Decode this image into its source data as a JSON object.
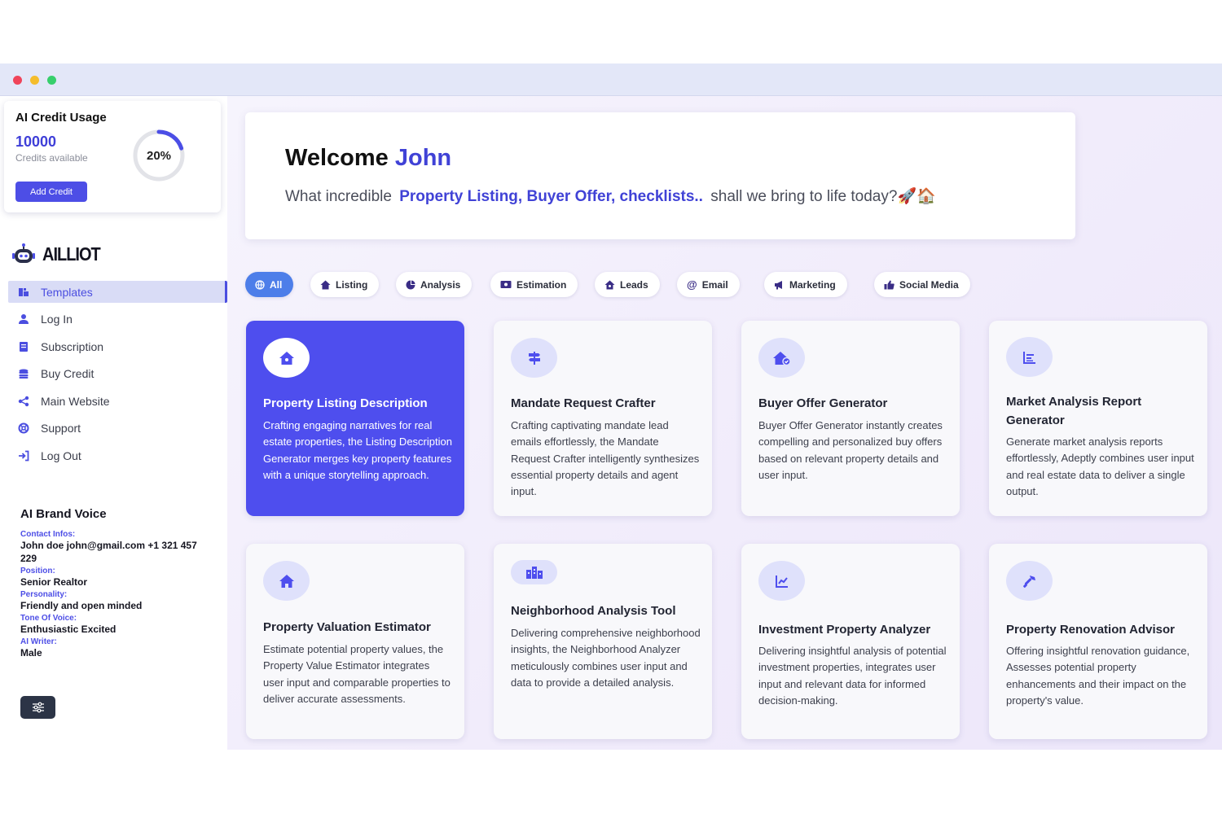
{
  "credit": {
    "title": "AI Credit Usage",
    "amount": "10000",
    "subtitle": "Credits available",
    "button": "Add Credit",
    "percent": "20%",
    "percent_value": 0.2
  },
  "logo": {
    "text": "AILLIOT"
  },
  "nav": {
    "items": [
      {
        "label": "Templates",
        "icon": "templates-icon"
      },
      {
        "label": "Log In",
        "icon": "user-icon"
      },
      {
        "label": "Subscription",
        "icon": "receipt-icon"
      },
      {
        "label": "Buy Credit",
        "icon": "coins-icon"
      },
      {
        "label": "Main Website",
        "icon": "share-icon"
      },
      {
        "label": "Support",
        "icon": "lifebuoy-icon"
      },
      {
        "label": "Log Out",
        "icon": "logout-icon"
      }
    ]
  },
  "brand": {
    "title": "AI Brand Voice",
    "contact_label": "Contact Infos:",
    "contact_value": "John doe john@gmail.com +1 321 457 229",
    "position_label": "Position:",
    "position_value": "Senior Realtor",
    "personality_label": "Personality:",
    "personality_value": "Friendly and open minded",
    "tone_label": "Tone Of Voice:",
    "tone_value": "Enthusiastic Excited",
    "writer_label": "AI Writer:",
    "writer_value": "Male"
  },
  "welcome": {
    "greeting": "Welcome",
    "name": "John",
    "prefix": "What incredible",
    "highlight": "Property Listing, Buyer Offer, checklists..",
    "suffix": "shall we bring to life today?🚀🏠"
  },
  "filters": [
    {
      "label": "All",
      "icon": "globe-icon"
    },
    {
      "label": "Listing",
      "icon": "house-icon"
    },
    {
      "label": "Analysis",
      "icon": "pie-chart-icon"
    },
    {
      "label": "Estimation",
      "icon": "money-icon"
    },
    {
      "label": "Leads",
      "icon": "house-icon"
    },
    {
      "label": "Email",
      "icon": "at-icon"
    },
    {
      "label": "Marketing",
      "icon": "megaphone-icon"
    },
    {
      "label": "Social Media",
      "icon": "thumbs-up-icon"
    }
  ],
  "cards": [
    {
      "title": "Property Listing Description",
      "desc": "Crafting engaging narratives for real estate properties, the Listing Description Generator merges key property features with a unique storytelling approach.",
      "icon": "house-icon"
    },
    {
      "title": "Mandate Request Crafter",
      "desc": "Crafting captivating mandate lead emails effortlessly, the Mandate Request Crafter intelligently synthesizes essential property details and agent input.",
      "icon": "signpost-icon"
    },
    {
      "title": "Buyer Offer Generator",
      "desc": "Buyer Offer Generator instantly creates compelling and personalized buy offers based on relevant property details and user input.",
      "icon": "house-check-icon"
    },
    {
      "title": "Market Analysis Report Generator",
      "desc": "Generate market analysis reports effortlessly, Adeptly combines user input and real estate data to deliver a single output.",
      "icon": "bar-chart-icon"
    },
    {
      "title": "Property Valuation Estimator",
      "desc": "Estimate potential property values, the Property Value Estimator integrates user input and comparable properties to deliver accurate assessments.",
      "icon": "house-icon"
    },
    {
      "title": "Neighborhood Analysis Tool",
      "desc": "Delivering comprehensive neighborhood insights, the Neighborhood Analyzer meticulously combines user input and data to provide a detailed analysis.",
      "icon": "city-icon"
    },
    {
      "title": "Investment Property Analyzer",
      "desc": "Delivering insightful analysis of potential investment properties, integrates user input and relevant data for informed decision-making.",
      "icon": "line-chart-icon"
    },
    {
      "title": "Property Renovation Advisor",
      "desc": "Offering insightful renovation guidance, Assesses potential property enhancements and their impact on the property's value.",
      "icon": "hammer-icon"
    }
  ],
  "colors": {
    "accent": "#4e4eee",
    "chip_active": "#4d7ee9",
    "highlight_text": "#4042d6"
  }
}
